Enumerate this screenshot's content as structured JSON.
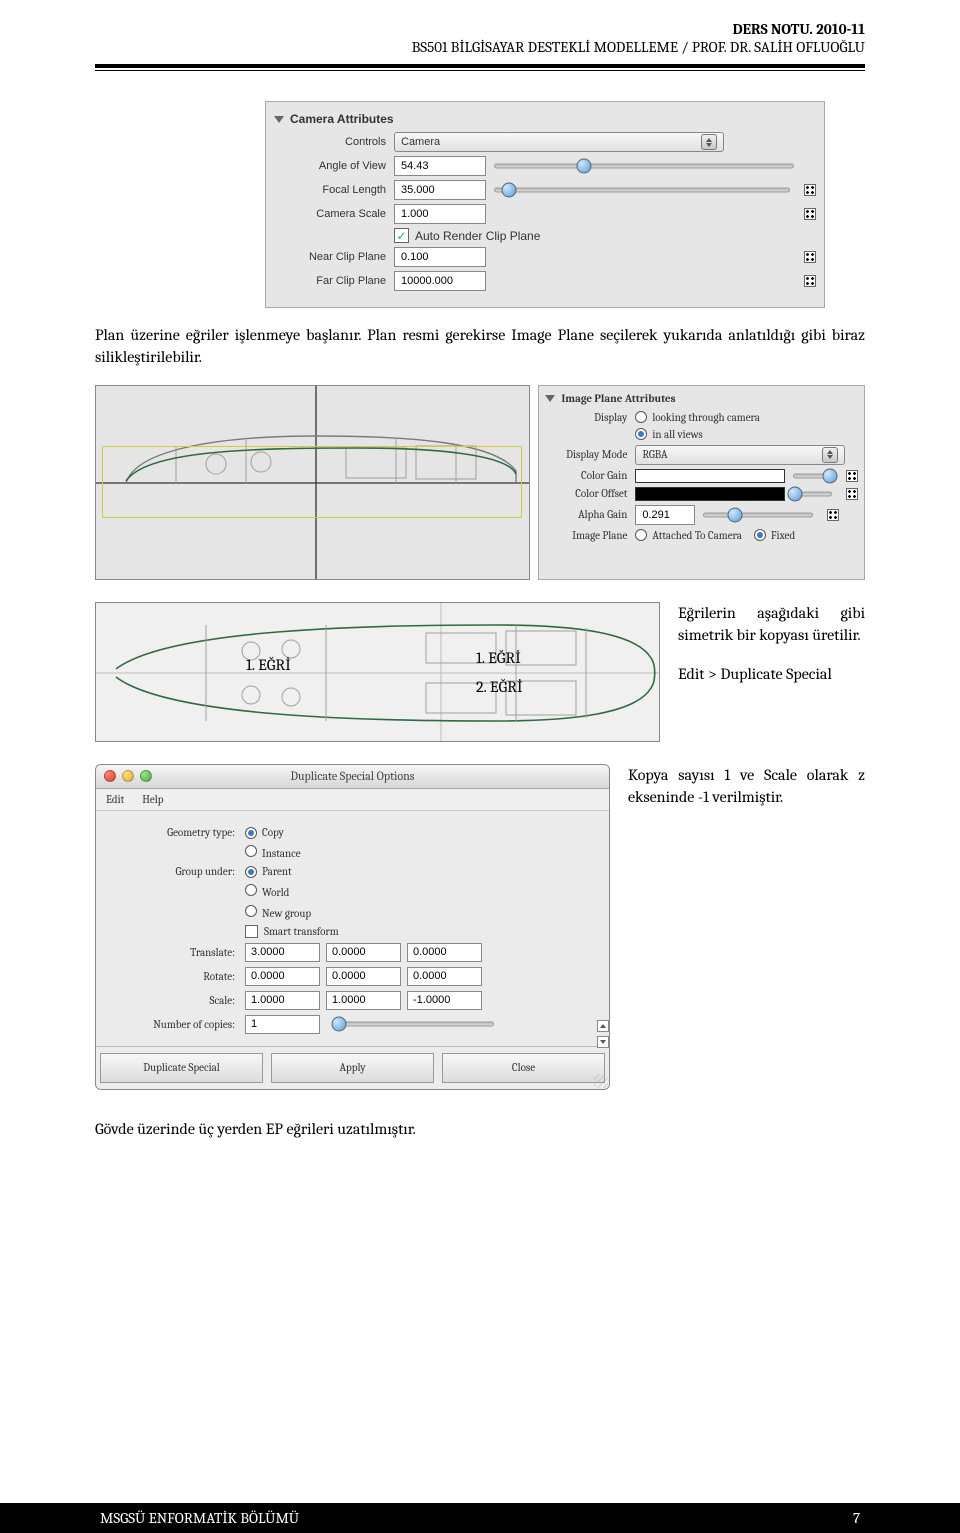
{
  "header": {
    "line1": "DERS NOTU. 2010-11",
    "line2": "BS501 BİLGİSAYAR DESTEKLİ MODELLEME / PROF. DR. SALİH OFLUOĞLU"
  },
  "camera_panel": {
    "title": "Camera Attributes",
    "controls_label": "Controls",
    "controls_value": "Camera",
    "angle_label": "Angle of View",
    "angle_value": "54.43",
    "focal_label": "Focal Length",
    "focal_value": "35.000",
    "scale_label": "Camera Scale",
    "scale_value": "1.000",
    "auto_clip_label": "Auto Render Clip Plane",
    "near_label": "Near Clip Plane",
    "near_value": "0.100",
    "far_label": "Far Clip Plane",
    "far_value": "10000.000"
  },
  "para1": "Plan üzerine eğriler işlenmeye başlanır. Plan resmi gerekirse Image Plane seçilerek yukarıda anlatıldığı gibi biraz silikleştirilebilir.",
  "imageplane_panel": {
    "title": "Image Plane Attributes",
    "display_label": "Display",
    "display_opt1": "looking through camera",
    "display_opt2": "in all views",
    "mode_label": "Display Mode",
    "mode_value": "RGBA",
    "gain_label": "Color Gain",
    "offset_label": "Color Offset",
    "alpha_label": "Alpha Gain",
    "alpha_value": "0.291",
    "plane_label": "Image Plane",
    "plane_opt1": "Attached To Camera",
    "plane_opt2": "Fixed"
  },
  "curves": {
    "c1a": "1. EĞRİ",
    "c1b": "1. EĞRİ",
    "c2": "2. EĞRİ"
  },
  "sidetext1_a": "Eğrilerin aşağıdaki gibi simetrik bir kopyası üretilir.",
  "sidetext1_b": "Edit > Duplicate Special",
  "sidetext2": "Kopya sayısı 1 ve Scale olarak z ekseninde -1 verilmiştir.",
  "dso": {
    "title": "Duplicate Special Options",
    "menu_edit": "Edit",
    "menu_help": "Help",
    "geom_label": "Geometry type:",
    "geom_opt1": "Copy",
    "geom_opt2": "Instance",
    "group_label": "Group under:",
    "group_opt1": "Parent",
    "group_opt2": "World",
    "group_opt3": "New group",
    "smart_label": "Smart transform",
    "translate_label": "Translate:",
    "rotate_label": "Rotate:",
    "scale_label": "Scale:",
    "translate": [
      "3.0000",
      "0.0000",
      "0.0000"
    ],
    "rotate": [
      "0.0000",
      "0.0000",
      "0.0000"
    ],
    "scale": [
      "1.0000",
      "1.0000",
      "-1.0000"
    ],
    "copies_label": "Number of copies:",
    "copies_value": "1",
    "btn1": "Duplicate Special",
    "btn2": "Apply",
    "btn3": "Close"
  },
  "para2": "Gövde üzerinde üç yerden EP eğrileri uzatılmıştır.",
  "footer": {
    "left": "MSGSÜ ENFORMATİK BÖLÜMÜ",
    "right": "7"
  }
}
